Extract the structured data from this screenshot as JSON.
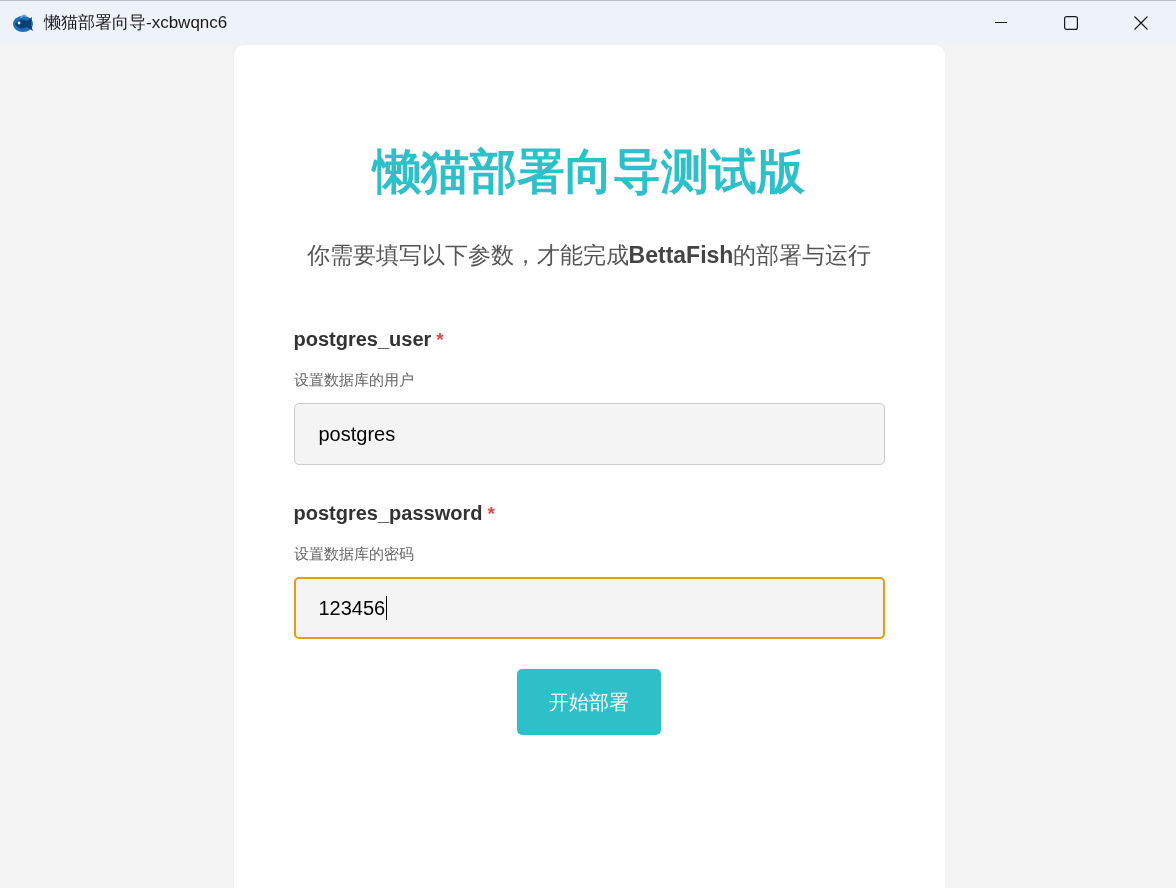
{
  "window": {
    "title": "懒猫部署向导-xcbwqnc6"
  },
  "heading": "懒猫部署向导测试版",
  "intro": "你需要填写以下参数，才能完成**BettaFish**的部署与运行",
  "fields": [
    {
      "label": "postgres_user",
      "required": true,
      "required_mark": "*",
      "hint": "设置数据库的用户",
      "value": "postgres",
      "focused": false
    },
    {
      "label": "postgres_password",
      "required": true,
      "required_mark": "*",
      "hint": "设置数据库的密码",
      "value": "123456",
      "focused": true
    }
  ],
  "submit_button": "开始部署"
}
